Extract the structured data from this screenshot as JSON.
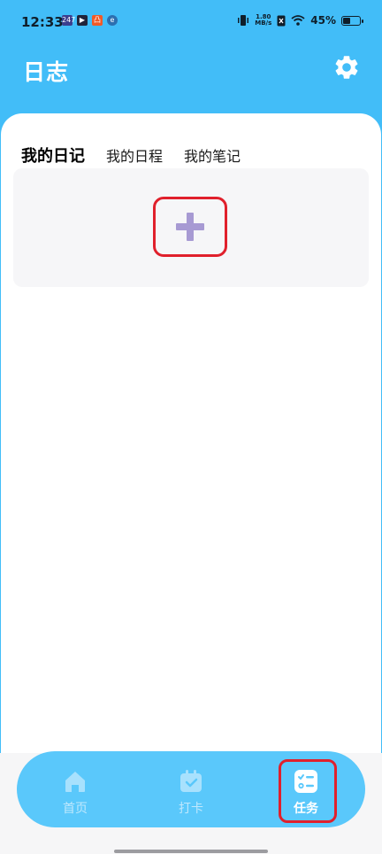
{
  "status_bar": {
    "time": "12:33",
    "app_icons": [
      "247",
      "▶",
      "凸",
      "e"
    ],
    "net_speed_value": "1.80",
    "net_speed_unit": "MB/s",
    "battery_percent_text": "45%",
    "battery_level": 0.45
  },
  "header": {
    "title": "日志",
    "settings_icon": "gear-icon"
  },
  "tabs": [
    {
      "label": "我的日记",
      "active": true
    },
    {
      "label": "我的日程",
      "active": false
    },
    {
      "label": "我的笔记",
      "active": false
    }
  ],
  "add_entry": {
    "icon": "plus-icon"
  },
  "bottom_nav": [
    {
      "label": "首页",
      "icon": "home-icon",
      "active": false
    },
    {
      "label": "打卡",
      "icon": "calendar-check-icon",
      "active": false
    },
    {
      "label": "任务",
      "icon": "task-list-icon",
      "active": true
    }
  ],
  "colors": {
    "header_bg": "#42bdf8",
    "nav_bg": "#5ac8fb",
    "plus": "#a79ad3",
    "highlight": "#e0202c"
  }
}
